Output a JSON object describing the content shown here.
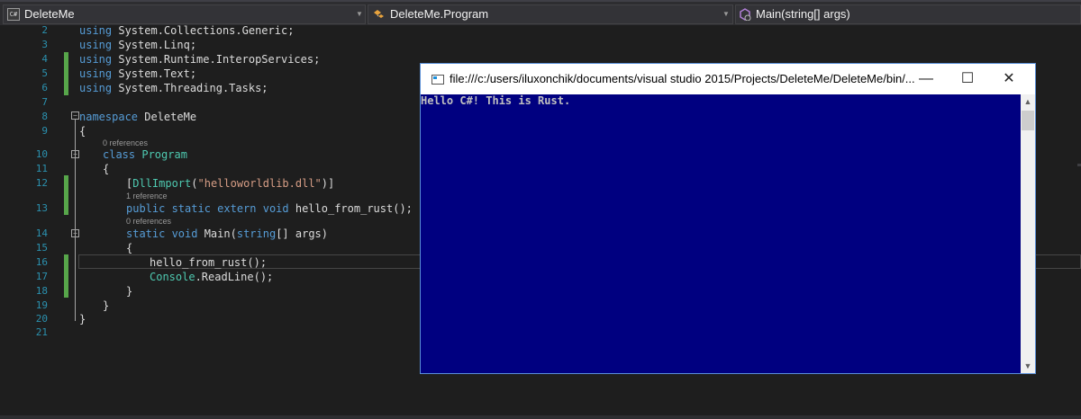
{
  "navbar": {
    "project_combo": "DeleteMe",
    "project_icon_text": "C#",
    "type_combo": "DeleteMe.Program",
    "member_combo": "Main(string[] args)"
  },
  "lines": [
    {
      "n": "2",
      "code": "using System.Collections.Generic;"
    },
    {
      "n": "3",
      "code": "using System.Linq;"
    },
    {
      "n": "4",
      "code": "using System.Runtime.InteropServices;"
    },
    {
      "n": "5",
      "code": "using System.Text;"
    },
    {
      "n": "6",
      "code": "using System.Threading.Tasks;"
    },
    {
      "n": "7",
      "code": ""
    },
    {
      "n": "8",
      "code": "namespace DeleteMe"
    },
    {
      "n": "9",
      "code": "{"
    },
    {
      "n": "10",
      "code": "class Program",
      "lens": "0 references"
    },
    {
      "n": "11",
      "code": "{"
    },
    {
      "n": "12",
      "code": "[DllImport(\"helloworldlib.dll\")]"
    },
    {
      "n": "13",
      "code": "public static extern void hello_from_rust();",
      "lens": "1 reference"
    },
    {
      "n": "14",
      "code": "static void Main(string[] args)",
      "lens": "0 references"
    },
    {
      "n": "15",
      "code": "{"
    },
    {
      "n": "16",
      "code": "hello_from_rust();"
    },
    {
      "n": "17",
      "code": "Console.ReadLine();"
    },
    {
      "n": "18",
      "code": "}"
    },
    {
      "n": "19",
      "code": "}"
    },
    {
      "n": "20",
      "code": "}"
    },
    {
      "n": "21",
      "code": ""
    }
  ],
  "console": {
    "title": "file:///c:/users/iluxonchik/documents/visual studio 2015/Projects/DeleteMe/DeleteMe/bin/...",
    "output": "Hello C#! This is Rust.",
    "minimize": "—",
    "maximize": "☐",
    "close": "✕",
    "bg_color": "#000080"
  }
}
